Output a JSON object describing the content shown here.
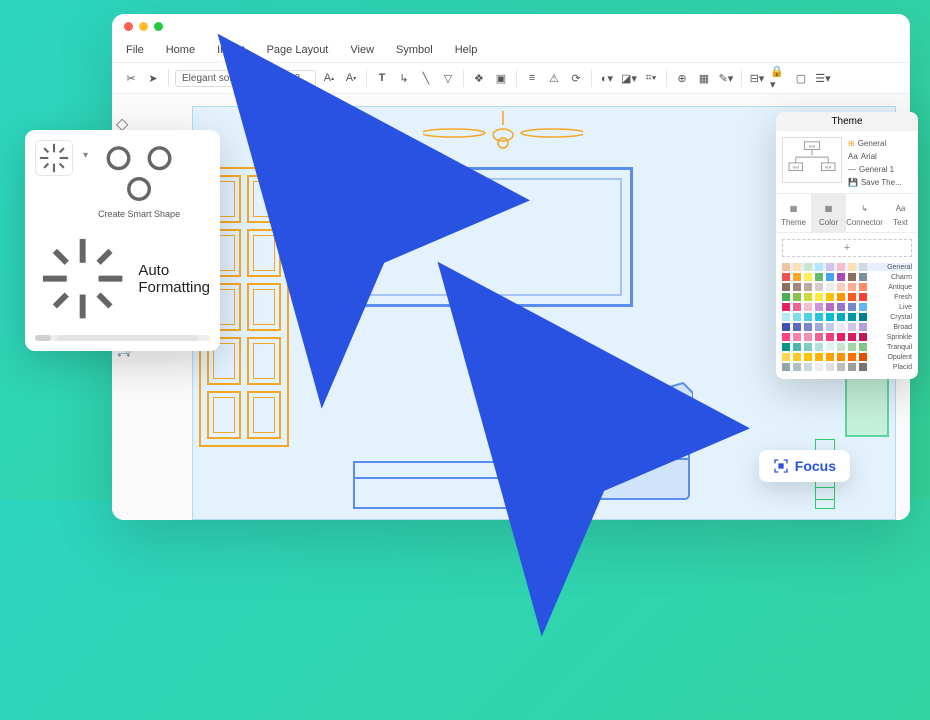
{
  "menu": {
    "file": "File",
    "home": "Home",
    "insert": "Insert",
    "page_layout": "Page Layout",
    "view": "View",
    "symbol": "Symbol",
    "help": "Help"
  },
  "toolbar": {
    "font": "Elegant soft black",
    "size": "12"
  },
  "auto_card": {
    "create_smart": "Create Smart Shape",
    "auto_formatting": "Auto Formatting"
  },
  "theme": {
    "title": "Theme",
    "opts": {
      "general": "General",
      "font": "Arial",
      "general1": "General 1",
      "save": "Save The..."
    },
    "tabs": {
      "theme": "Theme",
      "color": "Color",
      "connector": "Connector",
      "text": "Text"
    },
    "palettes": [
      "General",
      "Charm",
      "Antique",
      "Fresh",
      "Live",
      "Crystal",
      "Broad",
      "Sprinkle",
      "Tranquil",
      "Opulent",
      "Placid"
    ]
  },
  "focus": {
    "label": "Focus"
  }
}
